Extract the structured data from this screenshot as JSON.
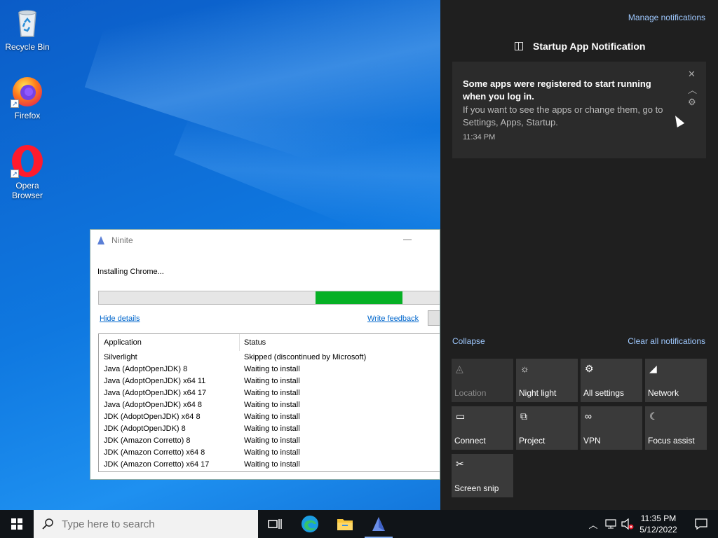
{
  "desktop": {
    "icons": [
      {
        "label": "Recycle Bin",
        "icon": "recycle-bin-icon"
      },
      {
        "label": "Firefox",
        "icon": "firefox-icon"
      },
      {
        "label": "Opera Browser",
        "icon": "opera-icon"
      }
    ]
  },
  "ninite": {
    "title": "Ninite",
    "minimize_glyph": "—",
    "status_text": "Installing Chrome...",
    "progress_percent": 25,
    "progress_color": "#06b025",
    "hide_details": "Hide details",
    "write_feedback": "Write feedback",
    "columns": [
      "Application",
      "Status"
    ],
    "rows": [
      {
        "app": "Silverlight",
        "status": "Skipped (discontinued by Microsoft)"
      },
      {
        "app": "Java (AdoptOpenJDK) 8",
        "status": "Waiting to install"
      },
      {
        "app": "Java (AdoptOpenJDK) x64 11",
        "status": "Waiting to install"
      },
      {
        "app": "Java (AdoptOpenJDK) x64 17",
        "status": "Waiting to install"
      },
      {
        "app": "Java (AdoptOpenJDK) x64 8",
        "status": "Waiting to install"
      },
      {
        "app": "JDK (AdoptOpenJDK) x64 8",
        "status": "Waiting to install"
      },
      {
        "app": "JDK (AdoptOpenJDK) 8",
        "status": "Waiting to install"
      },
      {
        "app": "JDK (Amazon Corretto) 8",
        "status": "Waiting to install"
      },
      {
        "app": "JDK (Amazon Corretto) x64 8",
        "status": "Waiting to install"
      },
      {
        "app": "JDK (Amazon Corretto) x64 17",
        "status": "Waiting to install"
      }
    ]
  },
  "action_center": {
    "manage": "Manage notifications",
    "group_title": "Startup App Notification",
    "toast": {
      "title": "Some apps were registered to start running when you log in.",
      "body": "If you want to see the apps or change them, go to Settings, Apps, Startup.",
      "time": "11:34 PM",
      "close_glyph": "✕",
      "collapse_glyph": "︿",
      "settings_glyph": "⚙"
    },
    "collapse": "Collapse",
    "clear_all": "Clear all notifications",
    "tiles": [
      {
        "label": "Location",
        "icon": "location-icon",
        "glyph": "◬",
        "dim": true
      },
      {
        "label": "Night light",
        "icon": "night-light-icon",
        "glyph": "☼",
        "dim": false
      },
      {
        "label": "All settings",
        "icon": "settings-icon",
        "glyph": "⚙",
        "dim": false
      },
      {
        "label": "Network",
        "icon": "network-icon",
        "glyph": "◢",
        "dim": false
      },
      {
        "label": "Connect",
        "icon": "connect-icon",
        "glyph": "▭",
        "dim": false
      },
      {
        "label": "Project",
        "icon": "project-icon",
        "glyph": "⧉",
        "dim": false
      },
      {
        "label": "VPN",
        "icon": "vpn-icon",
        "glyph": "∞",
        "dim": false
      },
      {
        "label": "Focus assist",
        "icon": "focus-assist-icon",
        "glyph": "☾",
        "dim": false
      },
      {
        "label": "Screen snip",
        "icon": "screen-snip-icon",
        "glyph": "✂",
        "dim": false
      }
    ]
  },
  "taskbar": {
    "search_placeholder": "Type here to search",
    "time": "11:35 PM",
    "date": "5/12/2022"
  }
}
